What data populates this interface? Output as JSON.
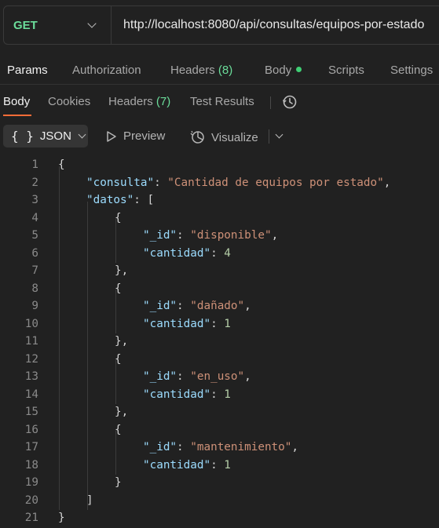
{
  "request": {
    "method": "GET",
    "url": "http://localhost:8080/api/consultas/equipos-por-estado"
  },
  "request_tabs": {
    "params": "Params",
    "authorization": "Authorization",
    "headers_label": "Headers",
    "headers_count": "(8)",
    "body": "Body",
    "scripts": "Scripts",
    "settings": "Settings"
  },
  "response_tabs": {
    "body": "Body",
    "cookies": "Cookies",
    "headers_label": "Headers",
    "headers_count": "(7)",
    "test_results": "Test Results"
  },
  "toolbar": {
    "format_braces": "{ }",
    "format_label": "JSON",
    "preview": "Preview",
    "visualize": "Visualize"
  },
  "colors": {
    "method": "#6bdd9a",
    "active_tab_underline": "#ff6c37",
    "json_key": "#9cdcfe",
    "json_string": "#ce9178",
    "json_number": "#b5cea8"
  },
  "code_lines": [
    {
      "n": "1",
      "text": "{"
    },
    {
      "n": "2",
      "key": "\"consulta\"",
      "sep": ": ",
      "str": "\"Cantidad de equipos por estado\"",
      "tail": ","
    },
    {
      "n": "3",
      "key": "\"datos\"",
      "sep": ": ",
      "tail": "["
    },
    {
      "n": "4",
      "text": "{"
    },
    {
      "n": "5",
      "key": "\"_id\"",
      "sep": ": ",
      "str": "\"disponible\"",
      "tail": ","
    },
    {
      "n": "6",
      "key": "\"cantidad\"",
      "sep": ": ",
      "num": "4"
    },
    {
      "n": "7",
      "text": "},"
    },
    {
      "n": "8",
      "text": "{"
    },
    {
      "n": "9",
      "key": "\"_id\"",
      "sep": ": ",
      "str": "\"dañado\"",
      "tail": ","
    },
    {
      "n": "10",
      "key": "\"cantidad\"",
      "sep": ": ",
      "num": "1"
    },
    {
      "n": "11",
      "text": "},"
    },
    {
      "n": "12",
      "text": "{"
    },
    {
      "n": "13",
      "key": "\"_id\"",
      "sep": ": ",
      "str": "\"en_uso\"",
      "tail": ","
    },
    {
      "n": "14",
      "key": "\"cantidad\"",
      "sep": ": ",
      "num": "1"
    },
    {
      "n": "15",
      "text": "},"
    },
    {
      "n": "16",
      "text": "{"
    },
    {
      "n": "17",
      "key": "\"_id\"",
      "sep": ": ",
      "str": "\"mantenimiento\"",
      "tail": ","
    },
    {
      "n": "18",
      "key": "\"cantidad\"",
      "sep": ": ",
      "num": "1"
    },
    {
      "n": "19",
      "text": "}"
    },
    {
      "n": "20",
      "text": "]"
    },
    {
      "n": "21",
      "text": "}"
    }
  ]
}
